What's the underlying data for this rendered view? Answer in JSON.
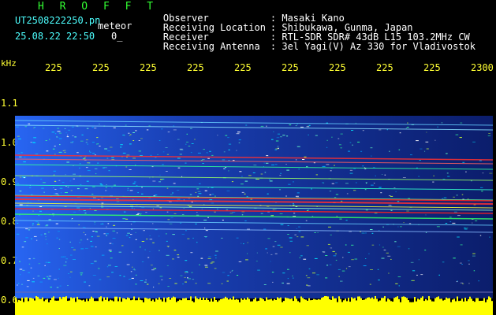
{
  "header": {
    "logo": "H R O F F T",
    "filename": "UT2508222250.pn",
    "type_label": "meteor",
    "timestamp": "25.08.22 22:50",
    "counter": "0_",
    "fields": [
      {
        "label": "Observer",
        "value": ": Masaki Kano"
      },
      {
        "label": "Receiving Location",
        "value": ": Shibukawa, Gunma, Japan"
      },
      {
        "label": "Receiver",
        "value": ": RTL-SDR SDR# 43dB L15 103.2MHz CW"
      },
      {
        "label": "Receiving Antenna",
        "value": ": 3el Yagi(V) Az 330 for Vladivostok"
      }
    ]
  },
  "axis": {
    "unit": "kHz",
    "time_ticks": [
      "225",
      "225",
      "225",
      "225",
      "225",
      "225",
      "225",
      "225",
      "225",
      "2300"
    ],
    "freq_ticks": [
      "1.1",
      "1.0",
      "0.9",
      "0.8",
      "0.7",
      "0.6"
    ]
  },
  "colors": {
    "header_green": "#33ff33",
    "header_white": "#ffffff",
    "tick_yellow": "#ffff33",
    "spectrogram_bg": "#000080",
    "signal_red": "#ff2020",
    "noise_yellow": "#ffff00"
  }
}
